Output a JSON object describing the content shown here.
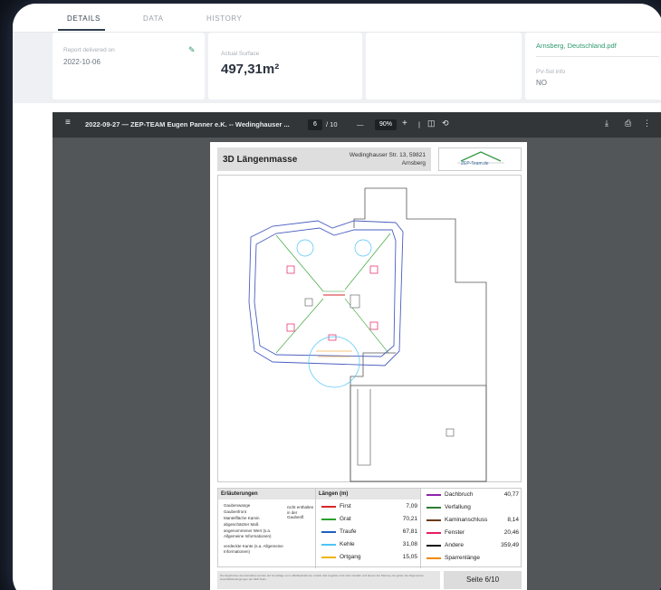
{
  "tabs": [
    {
      "label": "DETAILS",
      "active": true
    },
    {
      "label": "DATA",
      "active": false
    },
    {
      "label": "HISTORY",
      "active": false
    }
  ],
  "cards": {
    "report_label": "Report delivered on",
    "report_date": "2022-10-06",
    "surface_label": "Actual Surface",
    "surface_value": "497,31m²",
    "file_name": "Arnsberg, Deutschland.pdf",
    "pv_label": "PV-Sol info",
    "pv_value": "NO"
  },
  "viewer": {
    "doc_title": "2022-09-27 — ZEP-TEAM Eugen Panner e.K. -- Wedinghauser ...",
    "page_current": "6",
    "page_total": "/ 10",
    "zoom": "90%"
  },
  "page": {
    "title": "3D Längenmasse",
    "address_line1": "Wedinghauser Str. 13, 59821",
    "address_line2": "Arnsberg",
    "logo_text": "ZEP-Team.de",
    "legend_title": "Erläuterungen",
    "legend_notes": [
      "Gaubenwange",
      "Gaubenfront",
      "Mantelfläche Kamin",
      "abgeschätzter Maß",
      "angenommener Wert (s.a. Allgemeine Informationen)",
      "verdeckte Kante (s.a. Allgemeine Informationen)"
    ],
    "legend_brace_note": "nicht enthalten in der Gaubenfl.",
    "lengths_title": "Längen (m)",
    "lengths_left": [
      {
        "name": "First",
        "value": "7,09",
        "color": "#d62728"
      },
      {
        "name": "Grat",
        "value": "70,21",
        "color": "#2ca02c"
      },
      {
        "name": "Traufe",
        "value": "67,81",
        "color": "#1f5fbf"
      },
      {
        "name": "Kehle",
        "value": "31,08",
        "color": "#4fc3f7"
      },
      {
        "name": "Ortgang",
        "value": "15,05",
        "color": "#f0b400"
      }
    ],
    "lengths_right": [
      {
        "name": "Dachbruch",
        "value": "40,77",
        "color": "#8e24aa"
      },
      {
        "name": "Verfallung",
        "value": "",
        "color": "#2e7d32"
      },
      {
        "name": "Kaminanschluss",
        "value": "8,14",
        "color": "#6d3b1a"
      },
      {
        "name": "Fenster",
        "value": "20,46",
        "color": "#e91e63"
      },
      {
        "name": "Andere",
        "value": "359,49",
        "color": "#111111"
      },
      {
        "name": "Sparrenlänge",
        "value": "",
        "color": "#ef8a00"
      }
    ],
    "footer_text": "Die Ergebnisse des Aufmaßes wurden auf Grundlage von Luftbildaufnahmen erstellt. Alle Angaben sind ohne Gewähr und dienen der Planung. Es gelten die Allgemeinen Geschäftsbedingungen der ZEP-Team.",
    "page_label": "Seite 6/10"
  }
}
